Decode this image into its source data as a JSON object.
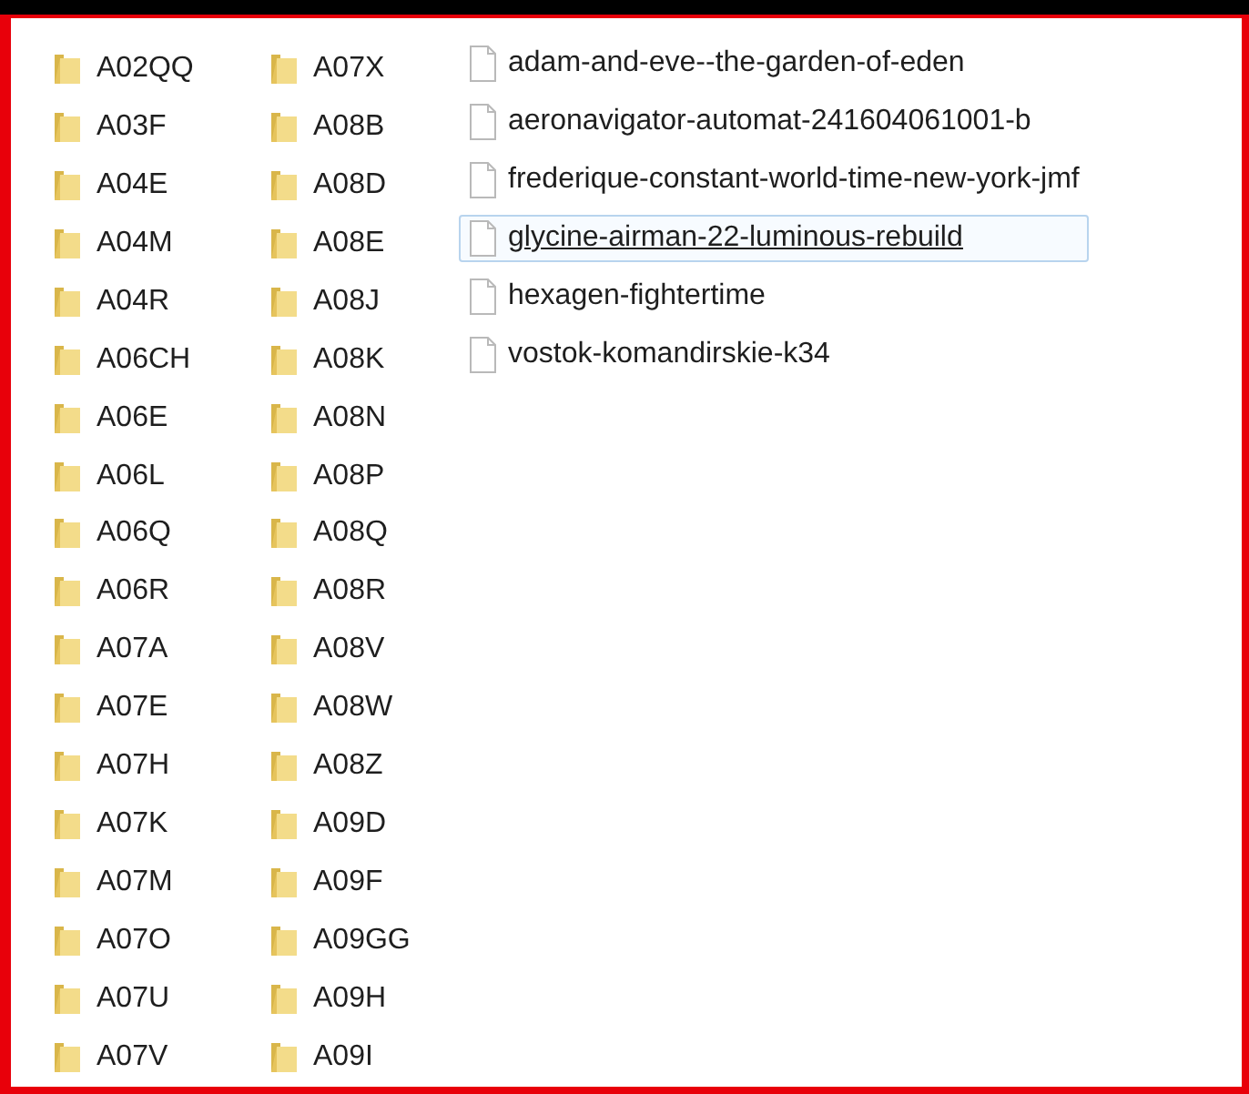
{
  "columns": [
    {
      "items": [
        {
          "kind": "folder",
          "name": "A02QQ",
          "selected": false
        },
        {
          "kind": "folder",
          "name": "A03F",
          "selected": false
        },
        {
          "kind": "folder",
          "name": "A04E",
          "selected": false
        },
        {
          "kind": "folder",
          "name": "A04M",
          "selected": false
        },
        {
          "kind": "folder",
          "name": "A04R",
          "selected": false
        },
        {
          "kind": "folder",
          "name": "A06CH",
          "selected": false
        },
        {
          "kind": "folder",
          "name": "A06E",
          "selected": false
        },
        {
          "kind": "folder",
          "name": "A06L",
          "selected": false
        },
        {
          "kind": "folder",
          "name": "A06Q",
          "selected": false
        },
        {
          "kind": "folder",
          "name": "A06R",
          "selected": false
        },
        {
          "kind": "folder",
          "name": "A07A",
          "selected": false
        },
        {
          "kind": "folder",
          "name": "A07E",
          "selected": false
        },
        {
          "kind": "folder",
          "name": "A07H",
          "selected": false
        },
        {
          "kind": "folder",
          "name": "A07K",
          "selected": false
        },
        {
          "kind": "folder",
          "name": "A07M",
          "selected": false
        },
        {
          "kind": "folder",
          "name": "A07O",
          "selected": false
        },
        {
          "kind": "folder",
          "name": "A07U",
          "selected": false
        },
        {
          "kind": "folder",
          "name": "A07V",
          "selected": false
        }
      ]
    },
    {
      "items": [
        {
          "kind": "folder",
          "name": "A07X",
          "selected": false
        },
        {
          "kind": "folder",
          "name": "A08B",
          "selected": false
        },
        {
          "kind": "folder",
          "name": "A08D",
          "selected": false
        },
        {
          "kind": "folder",
          "name": "A08E",
          "selected": false
        },
        {
          "kind": "folder",
          "name": "A08J",
          "selected": false
        },
        {
          "kind": "folder",
          "name": "A08K",
          "selected": false
        },
        {
          "kind": "folder",
          "name": "A08N",
          "selected": false
        },
        {
          "kind": "folder",
          "name": "A08P",
          "selected": false
        },
        {
          "kind": "folder",
          "name": "A08Q",
          "selected": false
        },
        {
          "kind": "folder",
          "name": "A08R",
          "selected": false
        },
        {
          "kind": "folder",
          "name": "A08V",
          "selected": false
        },
        {
          "kind": "folder",
          "name": "A08W",
          "selected": false
        },
        {
          "kind": "folder",
          "name": "A08Z",
          "selected": false
        },
        {
          "kind": "folder",
          "name": "A09D",
          "selected": false
        },
        {
          "kind": "folder",
          "name": "A09F",
          "selected": false
        },
        {
          "kind": "folder",
          "name": "A09GG",
          "selected": false
        },
        {
          "kind": "folder",
          "name": "A09H",
          "selected": false
        },
        {
          "kind": "folder",
          "name": "A09I",
          "selected": false
        }
      ]
    },
    {
      "items": [
        {
          "kind": "file",
          "name": "adam-and-eve--the-garden-of-eden",
          "selected": false
        },
        {
          "kind": "file",
          "name": "aeronavigator-automat-241604061001-b",
          "selected": false
        },
        {
          "kind": "file",
          "name": "frederique-constant-world-time-new-york-jmf",
          "selected": false
        },
        {
          "kind": "file",
          "name": "glycine-airman-22-luminous-rebuild",
          "selected": true
        },
        {
          "kind": "file",
          "name": "hexagen-fightertime",
          "selected": false
        },
        {
          "kind": "file",
          "name": "vostok-komandirskie-k34",
          "selected": false
        }
      ]
    }
  ]
}
